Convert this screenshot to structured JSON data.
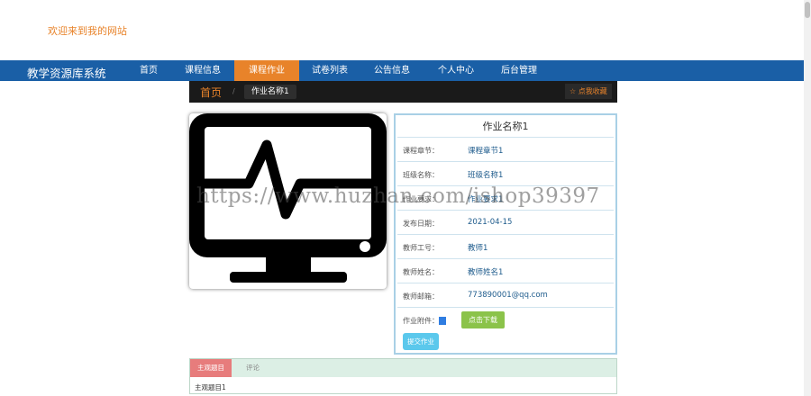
{
  "header": {
    "welcome": "欢迎来到我的网站"
  },
  "navbar": {
    "brand": "教学资源库系统",
    "items": [
      {
        "label": "首页"
      },
      {
        "label": "课程信息"
      },
      {
        "label": "课程作业",
        "active": true
      },
      {
        "label": "试卷列表"
      },
      {
        "label": "公告信息"
      },
      {
        "label": "个人中心"
      },
      {
        "label": "后台管理"
      }
    ],
    "color": "#1a5fa6",
    "active_color": "#e8832a"
  },
  "breadcrumb": {
    "home": "首页",
    "separator": "/",
    "current": "作业名称1"
  },
  "favorite": {
    "icon": "star-outline-icon",
    "label": "点我收藏"
  },
  "image": {
    "icon": "monitor-heartbeat-icon"
  },
  "detail": {
    "title": "作业名称1",
    "fields": [
      {
        "label": "课程章节：",
        "value": "课程章节1"
      },
      {
        "label": "班级名称：",
        "value": "班级名称1"
      },
      {
        "label": "作业要求：",
        "value": "作业要求1"
      },
      {
        "label": "发布日期：",
        "value": "2021-04-15"
      },
      {
        "label": "教师工号：",
        "value": "教师1"
      },
      {
        "label": "教师姓名：",
        "value": "教师姓名1"
      },
      {
        "label": "教师邮箱：",
        "value": "773890001@qq.com"
      }
    ],
    "attachment_label": "作业附件：",
    "download_button": "点击下载",
    "submit_button": "提交作业"
  },
  "tabs": {
    "items": [
      {
        "label": "主观题目",
        "active": true
      },
      {
        "label": "评论"
      }
    ],
    "content": "主观题目1"
  },
  "watermark": "https://www.huzhan.com/ishop39397"
}
